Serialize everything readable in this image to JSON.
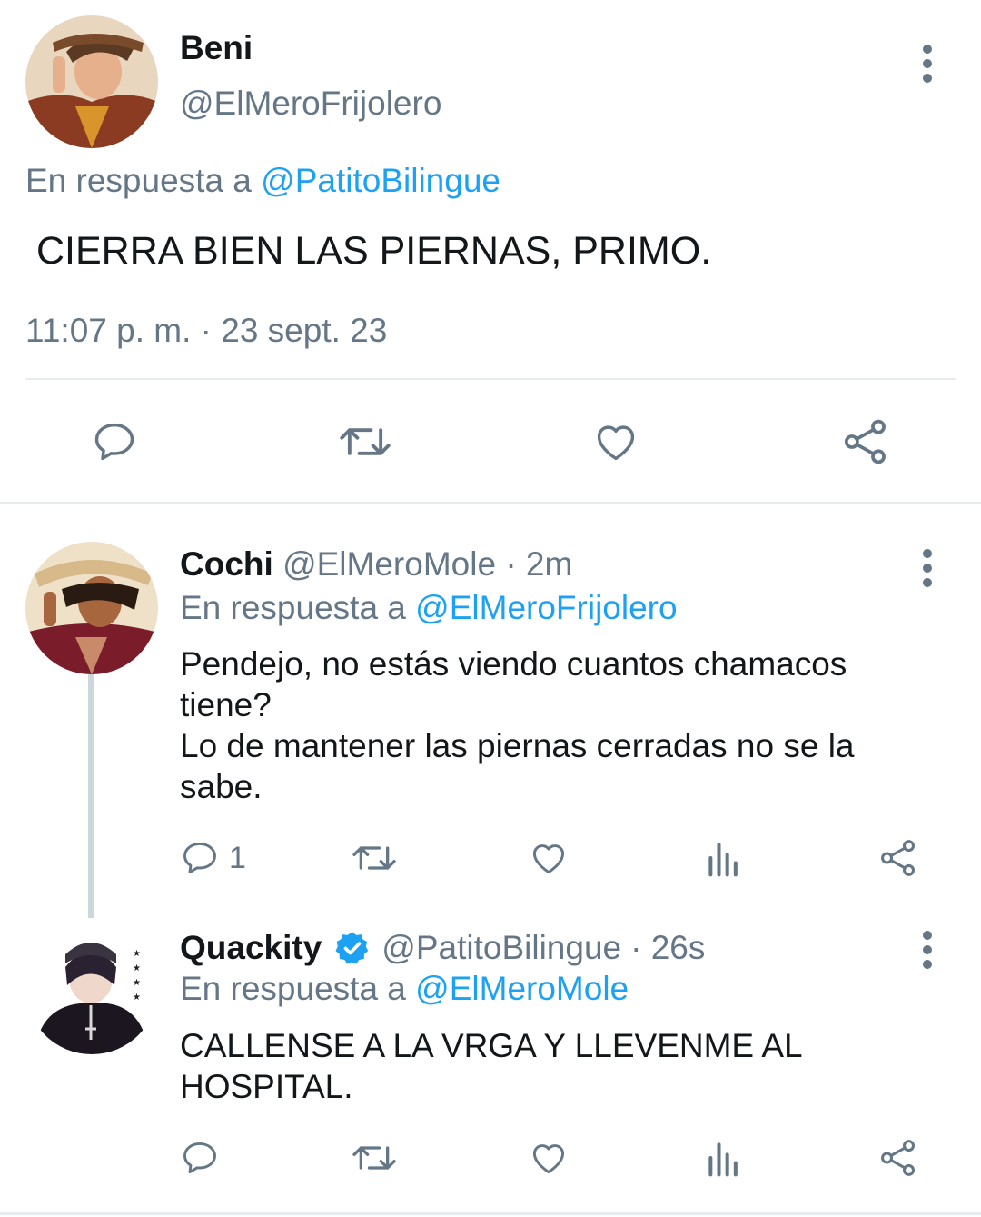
{
  "main_tweet": {
    "name": "Beni",
    "handle": "@ElMeroFrijolero",
    "reply_prefix": "En respuesta a",
    "reply_to": "@PatitoBilingue",
    "text": "CIERRA BIEN LAS PIERNAS, PRIMO.",
    "timestamp": "11:07 p. m. · 23 sept. 23"
  },
  "replies": [
    {
      "name": "Cochi",
      "handle": "@ElMeroMole",
      "time": "· 2m",
      "reply_prefix": "En respuesta a",
      "reply_to": "@ElMeroFrijolero",
      "text_lines": [
        "Pendejo, no estás viendo cuantos chamacos",
        "tiene?",
        "Lo de mantener las piernas cerradas no se la",
        "sabe."
      ],
      "reply_count": "1"
    },
    {
      "name": "Quackity",
      "verified": true,
      "handle": "@PatitoBilingue",
      "time": "· 26s",
      "reply_prefix": "En respuesta a",
      "reply_to": "@ElMeroMole",
      "text_lines": [
        "CALLENSE A LA VRGA Y LLEVENME AL",
        "HOSPITAL."
      ]
    }
  ],
  "colors": {
    "accent": "#1da1f2",
    "secondary_text": "#657786",
    "divider": "#e6ecf0"
  },
  "icons": [
    "reply-icon",
    "retweet-icon",
    "like-icon",
    "share-icon",
    "analytics-icon",
    "more-icon",
    "verified-icon"
  ]
}
